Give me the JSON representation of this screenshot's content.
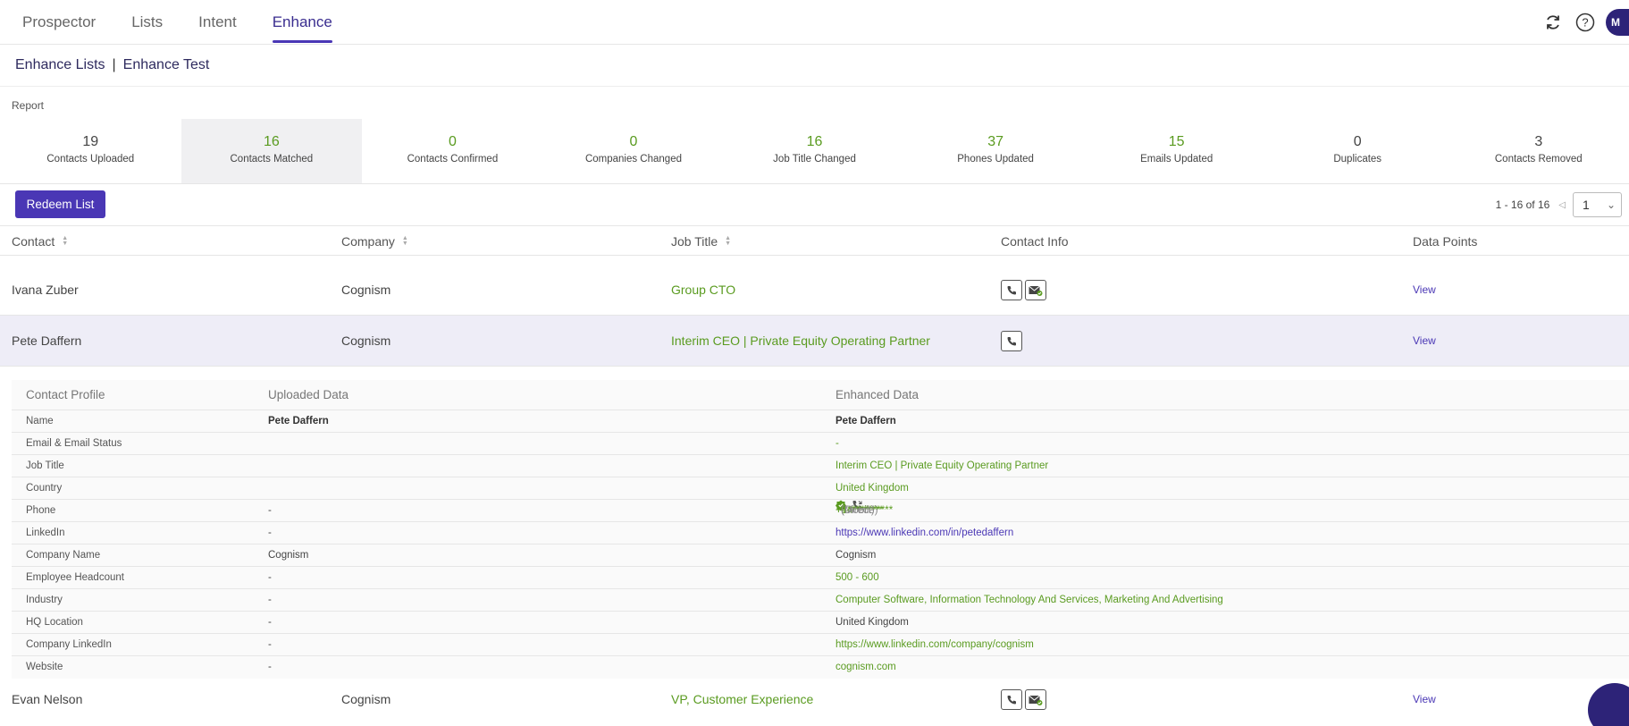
{
  "nav": {
    "tabs": [
      "Prospector",
      "Lists",
      "Intent",
      "Enhance"
    ],
    "active": "Enhance",
    "avatar": "M"
  },
  "breadcrumb": {
    "root": "Enhance Lists",
    "sep": "|",
    "current": "Enhance Test"
  },
  "report": {
    "label": "Report",
    "stats": [
      {
        "value": "19",
        "label": "Contacts Uploaded"
      },
      {
        "value": "16",
        "label": "Contacts Matched"
      },
      {
        "value": "0",
        "label": "Contacts Confirmed"
      },
      {
        "value": "0",
        "label": "Companies Changed"
      },
      {
        "value": "16",
        "label": "Job Title Changed"
      },
      {
        "value": "37",
        "label": "Phones Updated"
      },
      {
        "value": "15",
        "label": "Emails Updated"
      },
      {
        "value": "0",
        "label": "Duplicates"
      },
      {
        "value": "3",
        "label": "Contacts Removed"
      }
    ]
  },
  "toolbar": {
    "redeem_label": "Redeem List",
    "range": "1 - 16 of 16",
    "page": "1"
  },
  "table": {
    "columns": [
      "Contact",
      "Company",
      "Job Title",
      "Contact Info",
      "Data Points"
    ],
    "rows": [
      {
        "contact": "Ivana Zuber",
        "company": "Cognism",
        "job_title": "Group CTO",
        "view": "View",
        "has_email": true
      },
      {
        "contact": "Pete Daffern",
        "company": "Cognism",
        "job_title": "Interim CEO | Private Equity Operating Partner",
        "view": "View",
        "has_email": false
      },
      {
        "contact": "Evan Nelson",
        "company": "Cognism",
        "job_title": "VP, Customer Experience",
        "view": "View",
        "has_email": true
      }
    ]
  },
  "detail": {
    "headers": [
      "Contact Profile",
      "Uploaded Data",
      "Enhanced Data"
    ],
    "rows": [
      {
        "label": "Name",
        "uploaded": "Pete Daffern",
        "enhanced": "Pete Daffern"
      },
      {
        "label": "Email & Email Status",
        "uploaded": "",
        "enhanced": "-"
      },
      {
        "label": "Job Title",
        "uploaded": "",
        "enhanced": "Interim CEO | Private Equity Operating Partner"
      },
      {
        "label": "Country",
        "uploaded": "",
        "enhanced": "United Kingdom"
      },
      {
        "label": "Phone",
        "uploaded": "-",
        "enhanced": ""
      },
      {
        "label": "LinkedIn",
        "uploaded": "-",
        "enhanced": "https://www.linkedin.com/in/petedaffern"
      },
      {
        "label": "Company Name",
        "uploaded": "Cognism",
        "enhanced": "Cognism"
      },
      {
        "label": "Employee Headcount",
        "uploaded": "-",
        "enhanced": "500 - 600"
      },
      {
        "label": "Industry",
        "uploaded": "-",
        "enhanced": "Computer Software, Information Technology And Services, Marketing And Advertising"
      },
      {
        "label": "HQ Location",
        "uploaded": "-",
        "enhanced": "United Kingdom"
      },
      {
        "label": "Company LinkedIn",
        "uploaded": "-",
        "enhanced": "https://www.linkedin.com/company/cognism"
      },
      {
        "label": "Website",
        "uploaded": "-",
        "enhanced": "cognism.com"
      }
    ],
    "phones": [
      {
        "number": "+44**********",
        "type": "(Mobile)"
      },
      {
        "number": "+1*********",
        "type": "(Direct)"
      }
    ]
  }
}
